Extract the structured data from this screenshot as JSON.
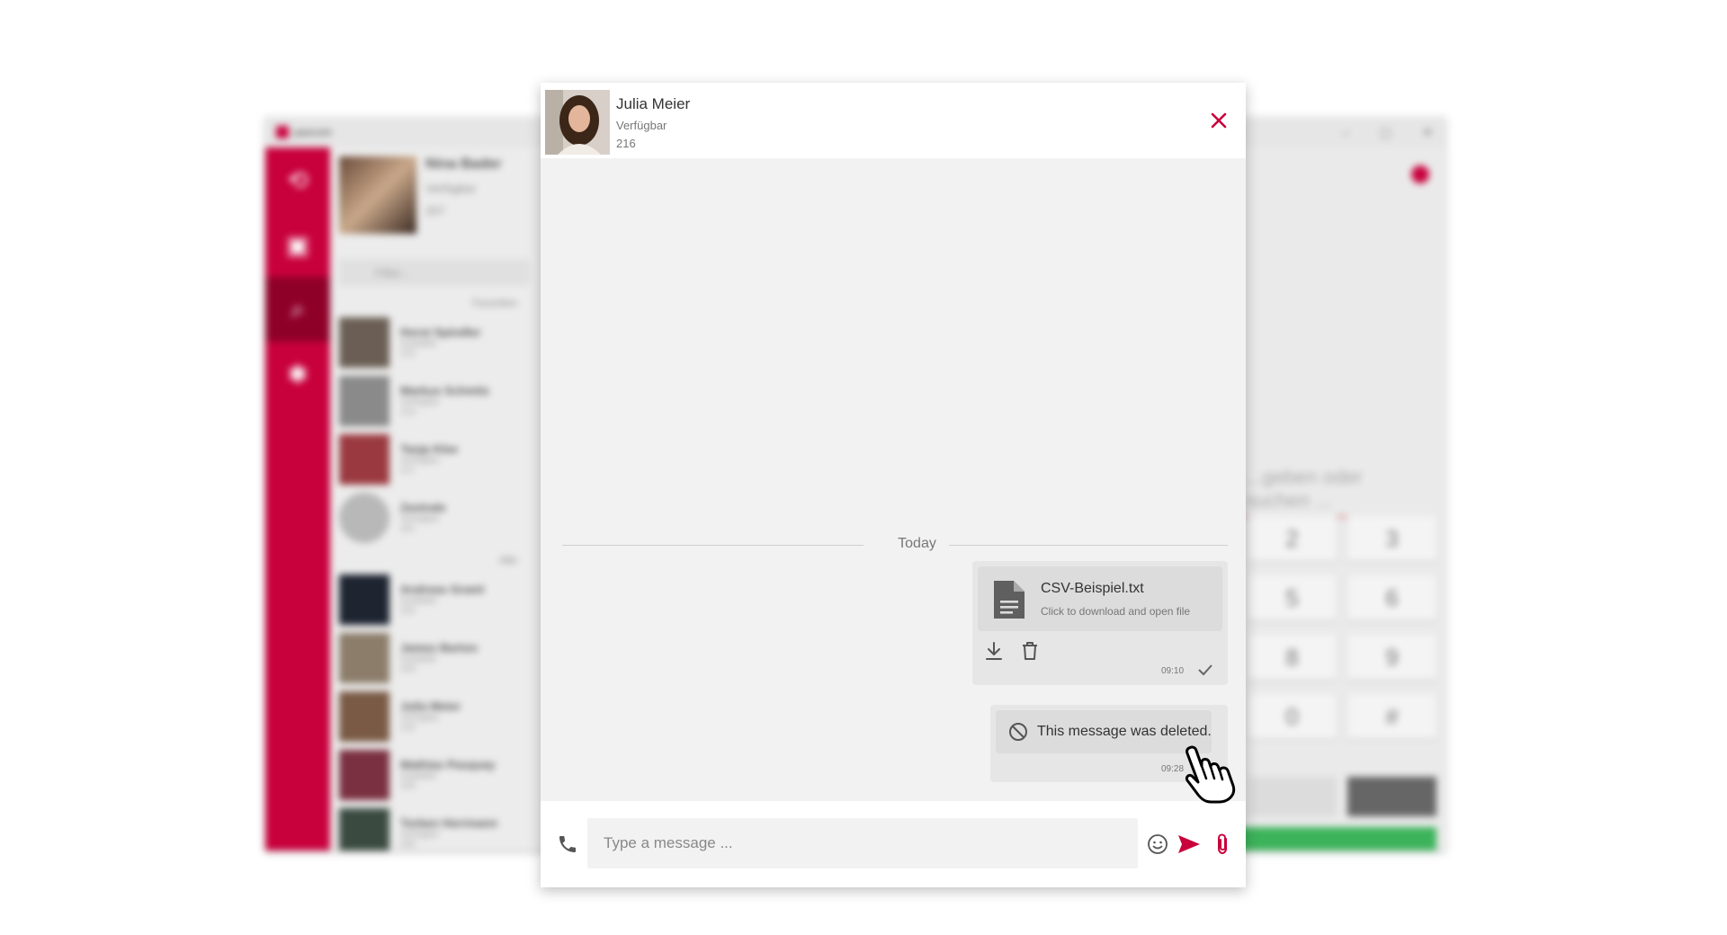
{
  "background_app": {
    "title": "pascom",
    "me": {
      "name": "Nina Bader",
      "status": "Verfügbar",
      "ext": "207"
    },
    "filter_placeholder": "Filter...",
    "group_favorites": "Favoriten",
    "group_all": "Alle",
    "contacts": [
      {
        "name": "Horst Spindler",
        "status": "Available",
        "ext": "215"
      },
      {
        "name": "Markus Schmitz",
        "status": "Verfügbar",
        "ext": "213"
      },
      {
        "name": "Tanja Klee",
        "status": "Verfügbar",
        "ext": "217"
      },
      {
        "name": "Zentrale",
        "status": "Verfügbar",
        "ext": "201"
      },
      {
        "name": "Andreas Graml",
        "status": "Available",
        "ext": "202"
      },
      {
        "name": "James Barton",
        "status": "Available",
        "ext": "203"
      },
      {
        "name": "Julia Meier",
        "status": "Verfügbar",
        "ext": "216"
      },
      {
        "name": "Mathias Pasquay",
        "status": "Available",
        "ext": "205"
      },
      {
        "name": "Torben Herrmann",
        "status": "Verfügbar",
        "ext": "206"
      }
    ],
    "dial_placeholder": "...geben oder suchen ...",
    "keys": [
      "2",
      "3",
      "5",
      "6",
      "8",
      "9",
      "0",
      "#"
    ]
  },
  "chat": {
    "contact_name": "Julia Meier",
    "contact_status": "Verfügbar",
    "contact_ext": "216",
    "date_divider": "Today",
    "file_message": {
      "file_name": "CSV-Beispiel.txt",
      "hint": "Click to download and open file",
      "time": "09:10"
    },
    "deleted_message": {
      "text": "This message was deleted.",
      "time": "09:28"
    },
    "input_placeholder": "Type a message ..."
  },
  "colors": {
    "accent": "#c8003c",
    "call_green": "#3cb35a"
  }
}
